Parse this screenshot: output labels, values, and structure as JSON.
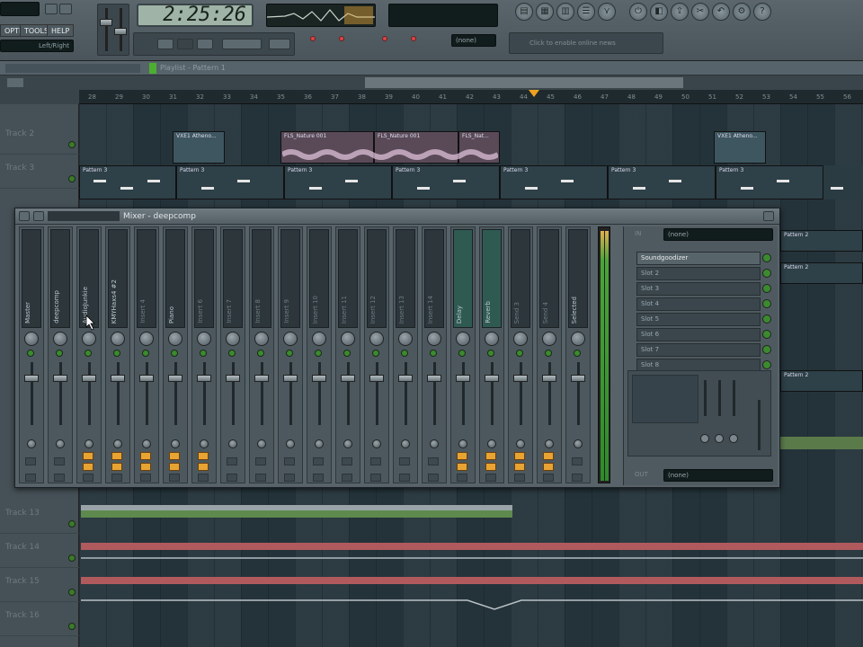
{
  "toolbar": {
    "menus": [
      "OPTIONS",
      "TOOLS",
      "HELP"
    ],
    "time": "2:25:26",
    "tempo_mode": "Left/Right",
    "hint": "Click to enable online news",
    "none_label": "(none)"
  },
  "playlist": {
    "title": "Playlist - Pattern 1",
    "tracks": [
      {
        "label": "Track 2"
      },
      {
        "label": "Track 3"
      },
      {
        "label": "Track 13"
      },
      {
        "label": "Track 14"
      },
      {
        "label": "Track 15"
      },
      {
        "label": "Track 16"
      }
    ],
    "clips": [
      {
        "label": "VXE1 Atheno..."
      },
      {
        "label": "FLS_Nature 001"
      },
      {
        "label": "FLS_Nature 001"
      },
      {
        "label": "FLS_Nat..."
      },
      {
        "label": "VXE1 Atheno..."
      }
    ],
    "patterns": [
      "Pattern 3",
      "Pattern 3",
      "Pattern 3",
      "Pattern 3",
      "Pattern 3",
      "Pattern 3",
      "Pattern 3"
    ],
    "right_patterns": [
      "Pattern 2",
      "Pattern 2",
      "Pattern 2"
    ],
    "ruler_numbers": [
      "28",
      "29",
      "30",
      "31",
      "32",
      "33",
      "34",
      "35",
      "36",
      "37",
      "38",
      "39",
      "40",
      "41",
      "42",
      "43",
      "44",
      "45",
      "46",
      "47",
      "48",
      "49",
      "50",
      "51",
      "52",
      "53",
      "54",
      "55",
      "56"
    ]
  },
  "mixer": {
    "title": "Mixer - deepcomp",
    "strips": [
      {
        "name": "Master",
        "highlight": true
      },
      {
        "name": "deepcomp",
        "highlight": true
      },
      {
        "name": "AudioJunkie",
        "highlight": true
      },
      {
        "name": "KMYHaxs4 #2",
        "highlight": true
      },
      {
        "name": "Insert 4",
        "highlight": false
      },
      {
        "name": "Piano",
        "highlight": true
      },
      {
        "name": "Insert 6",
        "highlight": false
      },
      {
        "name": "Insert 7",
        "highlight": false
      },
      {
        "name": "Insert 8",
        "highlight": false
      },
      {
        "name": "Insert 9",
        "highlight": false
      },
      {
        "name": "Insert 10",
        "highlight": false
      },
      {
        "name": "Insert 11",
        "highlight": false
      },
      {
        "name": "Insert 12",
        "highlight": false
      },
      {
        "name": "Insert 13",
        "highlight": false
      },
      {
        "name": "Insert 14",
        "highlight": false
      },
      {
        "name": "Delay",
        "highlight": true
      },
      {
        "name": "Reverb",
        "highlight": true
      },
      {
        "name": "Send 3",
        "highlight": false
      },
      {
        "name": "Send 4",
        "highlight": false
      },
      {
        "name": "Selected",
        "highlight": true
      }
    ],
    "fx_in": "(none)",
    "fx_slots": [
      "Soundgoodizer",
      "Slot 2",
      "Slot 3",
      "Slot 4",
      "Slot 5",
      "Slot 6",
      "Slot 7",
      "Slot 8"
    ],
    "fx_out": "(none)",
    "in_label": "IN",
    "out_label": "OUT"
  },
  "colors": {
    "accent_green": "#3b8a2f",
    "clip_pink": "#b7a6c0",
    "pattern_orange": "#e8a432"
  }
}
